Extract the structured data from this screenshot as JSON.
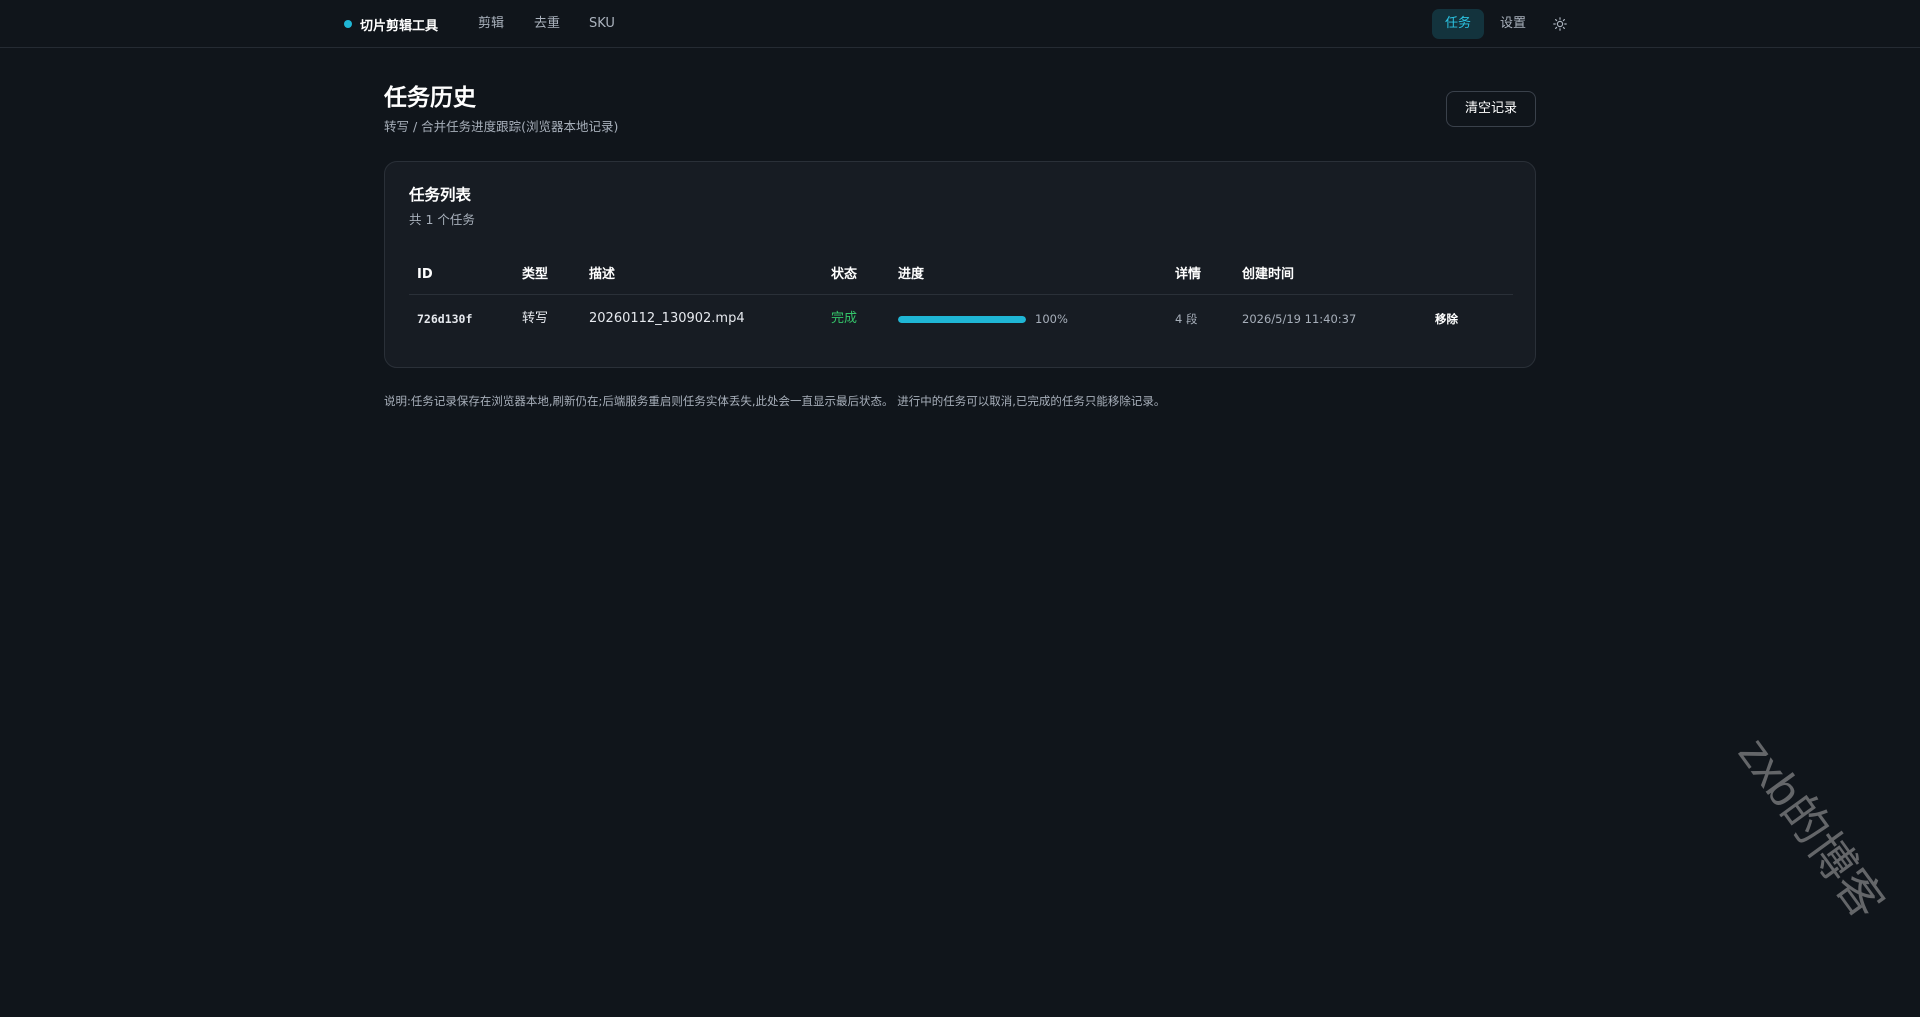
{
  "nav": {
    "brand": "切片剪辑工具",
    "links": [
      "剪辑",
      "去重",
      "SKU"
    ],
    "tasks": "任务",
    "settings": "设置",
    "theme_icon": "sun-icon",
    "accent": "#1fb6d5"
  },
  "header": {
    "title": "任务历史",
    "subtitle": "转写 / 合并任务进度跟踪(浏览器本地记录)",
    "clear_button": "清空记录"
  },
  "card": {
    "title": "任务列表",
    "subtitle": "共 1 个任务",
    "columns": [
      "ID",
      "类型",
      "描述",
      "状态",
      "进度",
      "详情",
      "创建时间"
    ],
    "rows": [
      {
        "id": "726d130f",
        "type": "转写",
        "description": "20260112_130902.mp4",
        "status": "完成",
        "progress": 100,
        "progress_label": "100%",
        "detail": "4 段",
        "created": "2026/5/19 11:40:37",
        "action": "移除"
      }
    ]
  },
  "note": "说明:任务记录保存在浏览器本地,刷新仍在;后端服务重启则任务实体丢失,此处会一直显示最后状态。 进行中的任务可以取消,已完成的任务只能移除记录。",
  "watermark": "zxb的博客"
}
